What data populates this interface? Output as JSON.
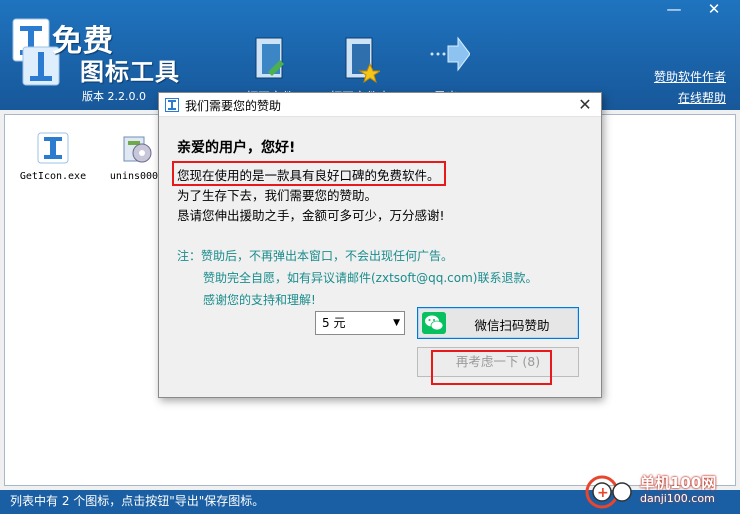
{
  "app": {
    "logo_free": "免费",
    "logo_name": "图标工具",
    "version": "版本 2.2.0.0",
    "toolbar": [
      {
        "label": "打开文件",
        "icon": "open-file-icon"
      },
      {
        "label": "打开文件夹",
        "icon": "open-folder-icon"
      },
      {
        "label": "导出",
        "icon": "export-icon"
      }
    ],
    "links": {
      "sponsor": "赞助软件作者",
      "help": "在线帮助"
    },
    "window_buttons": {
      "minimize": "—",
      "close": "✕"
    },
    "files": [
      {
        "name": "GetIcon.exe",
        "icon": "app-icon"
      },
      {
        "name": "unins000.",
        "icon": "installer-icon"
      }
    ],
    "status": "列表中有 2 个图标，点击按钮\"导出\"保存图标。",
    "watermark": {
      "text": "单机100网",
      "url": "danji100.com"
    }
  },
  "dialog": {
    "title": "我们需要您的赞助",
    "close": "✕",
    "greeting": "亲爱的用户，您好!",
    "line1": "您现在使用的是一款具有良好口碑的免费软件。",
    "line2": "为了生存下去，我们需要您的赞助。",
    "line3": "恳请您伸出援助之手，金额可多可少，万分感谢!",
    "note1": "注：赞助后，不再弹出本窗口，不会出现任何广告。",
    "note2": "赞助完全自愿，如有异议请邮件(zxtsoft@qq.com)联系退款。",
    "note3": "感谢您的支持和理解!",
    "amount": "5 元",
    "wechat_button": "微信扫码赞助",
    "later_button": "再考虑一下 (8)"
  },
  "colors": {
    "header_blue": "#1a62a8",
    "highlight_red": "#e8191b",
    "note_teal": "#1b8c8c",
    "wechat_green": "#07c160"
  }
}
